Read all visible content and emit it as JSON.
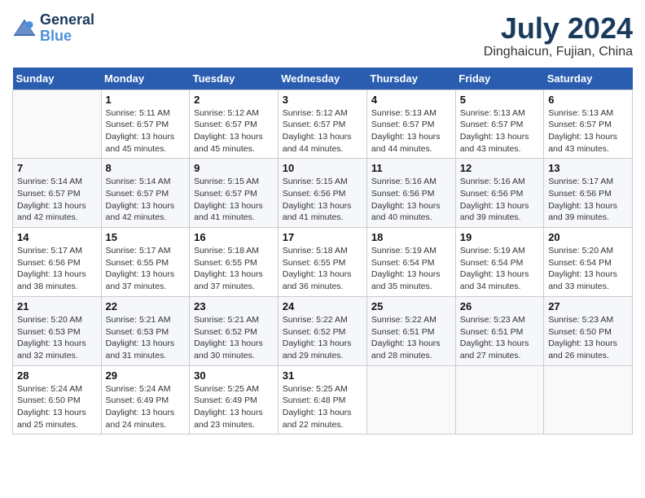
{
  "logo": {
    "line1": "General",
    "line2": "Blue"
  },
  "title": {
    "month_year": "July 2024",
    "location": "Dinghaicun, Fujian, China"
  },
  "days_header": [
    "Sunday",
    "Monday",
    "Tuesday",
    "Wednesday",
    "Thursday",
    "Friday",
    "Saturday"
  ],
  "weeks": [
    [
      {
        "day": "",
        "info": ""
      },
      {
        "day": "1",
        "info": "Sunrise: 5:11 AM\nSunset: 6:57 PM\nDaylight: 13 hours\nand 45 minutes."
      },
      {
        "day": "2",
        "info": "Sunrise: 5:12 AM\nSunset: 6:57 PM\nDaylight: 13 hours\nand 45 minutes."
      },
      {
        "day": "3",
        "info": "Sunrise: 5:12 AM\nSunset: 6:57 PM\nDaylight: 13 hours\nand 44 minutes."
      },
      {
        "day": "4",
        "info": "Sunrise: 5:13 AM\nSunset: 6:57 PM\nDaylight: 13 hours\nand 44 minutes."
      },
      {
        "day": "5",
        "info": "Sunrise: 5:13 AM\nSunset: 6:57 PM\nDaylight: 13 hours\nand 43 minutes."
      },
      {
        "day": "6",
        "info": "Sunrise: 5:13 AM\nSunset: 6:57 PM\nDaylight: 13 hours\nand 43 minutes."
      }
    ],
    [
      {
        "day": "7",
        "info": "Sunrise: 5:14 AM\nSunset: 6:57 PM\nDaylight: 13 hours\nand 42 minutes."
      },
      {
        "day": "8",
        "info": "Sunrise: 5:14 AM\nSunset: 6:57 PM\nDaylight: 13 hours\nand 42 minutes."
      },
      {
        "day": "9",
        "info": "Sunrise: 5:15 AM\nSunset: 6:57 PM\nDaylight: 13 hours\nand 41 minutes."
      },
      {
        "day": "10",
        "info": "Sunrise: 5:15 AM\nSunset: 6:56 PM\nDaylight: 13 hours\nand 41 minutes."
      },
      {
        "day": "11",
        "info": "Sunrise: 5:16 AM\nSunset: 6:56 PM\nDaylight: 13 hours\nand 40 minutes."
      },
      {
        "day": "12",
        "info": "Sunrise: 5:16 AM\nSunset: 6:56 PM\nDaylight: 13 hours\nand 39 minutes."
      },
      {
        "day": "13",
        "info": "Sunrise: 5:17 AM\nSunset: 6:56 PM\nDaylight: 13 hours\nand 39 minutes."
      }
    ],
    [
      {
        "day": "14",
        "info": "Sunrise: 5:17 AM\nSunset: 6:56 PM\nDaylight: 13 hours\nand 38 minutes."
      },
      {
        "day": "15",
        "info": "Sunrise: 5:17 AM\nSunset: 6:55 PM\nDaylight: 13 hours\nand 37 minutes."
      },
      {
        "day": "16",
        "info": "Sunrise: 5:18 AM\nSunset: 6:55 PM\nDaylight: 13 hours\nand 37 minutes."
      },
      {
        "day": "17",
        "info": "Sunrise: 5:18 AM\nSunset: 6:55 PM\nDaylight: 13 hours\nand 36 minutes."
      },
      {
        "day": "18",
        "info": "Sunrise: 5:19 AM\nSunset: 6:54 PM\nDaylight: 13 hours\nand 35 minutes."
      },
      {
        "day": "19",
        "info": "Sunrise: 5:19 AM\nSunset: 6:54 PM\nDaylight: 13 hours\nand 34 minutes."
      },
      {
        "day": "20",
        "info": "Sunrise: 5:20 AM\nSunset: 6:54 PM\nDaylight: 13 hours\nand 33 minutes."
      }
    ],
    [
      {
        "day": "21",
        "info": "Sunrise: 5:20 AM\nSunset: 6:53 PM\nDaylight: 13 hours\nand 32 minutes."
      },
      {
        "day": "22",
        "info": "Sunrise: 5:21 AM\nSunset: 6:53 PM\nDaylight: 13 hours\nand 31 minutes."
      },
      {
        "day": "23",
        "info": "Sunrise: 5:21 AM\nSunset: 6:52 PM\nDaylight: 13 hours\nand 30 minutes."
      },
      {
        "day": "24",
        "info": "Sunrise: 5:22 AM\nSunset: 6:52 PM\nDaylight: 13 hours\nand 29 minutes."
      },
      {
        "day": "25",
        "info": "Sunrise: 5:22 AM\nSunset: 6:51 PM\nDaylight: 13 hours\nand 28 minutes."
      },
      {
        "day": "26",
        "info": "Sunrise: 5:23 AM\nSunset: 6:51 PM\nDaylight: 13 hours\nand 27 minutes."
      },
      {
        "day": "27",
        "info": "Sunrise: 5:23 AM\nSunset: 6:50 PM\nDaylight: 13 hours\nand 26 minutes."
      }
    ],
    [
      {
        "day": "28",
        "info": "Sunrise: 5:24 AM\nSunset: 6:50 PM\nDaylight: 13 hours\nand 25 minutes."
      },
      {
        "day": "29",
        "info": "Sunrise: 5:24 AM\nSunset: 6:49 PM\nDaylight: 13 hours\nand 24 minutes."
      },
      {
        "day": "30",
        "info": "Sunrise: 5:25 AM\nSunset: 6:49 PM\nDaylight: 13 hours\nand 23 minutes."
      },
      {
        "day": "31",
        "info": "Sunrise: 5:25 AM\nSunset: 6:48 PM\nDaylight: 13 hours\nand 22 minutes."
      },
      {
        "day": "",
        "info": ""
      },
      {
        "day": "",
        "info": ""
      },
      {
        "day": "",
        "info": ""
      }
    ]
  ]
}
